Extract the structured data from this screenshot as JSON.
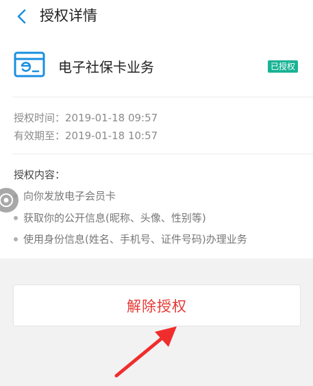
{
  "header": {
    "back_icon": "chevron-left-icon",
    "title": "授权详情"
  },
  "service": {
    "icon": "e-card-icon",
    "name": "电子社保卡业务",
    "status_badge": "已授权",
    "badge_color": "#19b395"
  },
  "auth_info": {
    "auth_time": "授权时间：2019-01-18 09:57",
    "valid_until": "有效期至：2019-01-18 10:57"
  },
  "permissions": {
    "title": "授权内容：",
    "items": [
      "向你发放电子会员卡",
      "获取你的公开信息(昵称、头像、性别等)",
      "使用身份信息(姓名、手机号、证件号码)办理业务"
    ]
  },
  "actions": {
    "revoke_label": "解除授权",
    "revoke_color": "#e53935"
  },
  "accent_color": "#1a8fe0"
}
